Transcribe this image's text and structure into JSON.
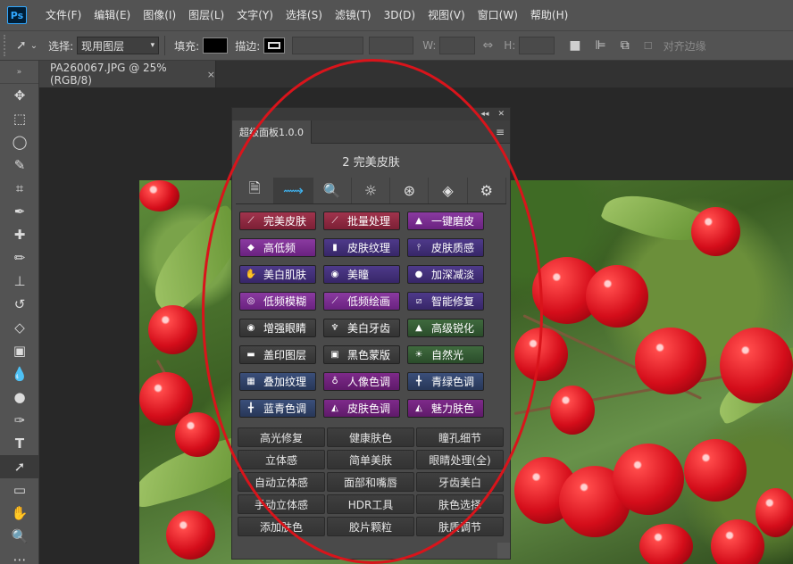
{
  "app": {
    "logo": "Ps"
  },
  "menu": [
    "文件(F)",
    "编辑(E)",
    "图像(I)",
    "图层(L)",
    "文字(Y)",
    "选择(S)",
    "滤镜(T)",
    "3D(D)",
    "视图(V)",
    "窗口(W)",
    "帮助(H)"
  ],
  "options": {
    "select_label": "选择:",
    "select_value": "现用图层",
    "fill_label": "填充:",
    "stroke_label": "描边:",
    "w_label": "W:",
    "h_label": "H:",
    "align_edges": "对齐边缘"
  },
  "document_tab": {
    "title": "PA260067.JPG @ 25%(RGB/8)",
    "close": "×"
  },
  "toolbar": {
    "icons": [
      "move-icon",
      "marquee-icon",
      "lasso-icon",
      "quick-select-icon",
      "crop-icon",
      "eyedropper-icon",
      "healing-brush-icon",
      "brush-icon",
      "clone-stamp-icon",
      "history-brush-icon",
      "eraser-icon",
      "gradient-icon",
      "blur-icon",
      "dodge-icon",
      "pen-icon",
      "type-icon",
      "path-select-icon",
      "rectangle-icon",
      "hand-icon",
      "zoom-icon",
      "more-icon"
    ]
  },
  "panel": {
    "tab_title": "超级面板1.0.0",
    "subtitle": "2 完美皮肤",
    "icon_tabs": [
      "document-icon",
      "pulse-icon",
      "search-icon",
      "light-icon",
      "circles-icon",
      "diamond-icon",
      "settings-icon"
    ],
    "buttons": [
      [
        {
          "label": "完美皮肤",
          "color": "red",
          "icon": "brush-icon"
        },
        {
          "label": "批量处理",
          "color": "red",
          "icon": "brush-icon"
        },
        {
          "label": "一键磨皮",
          "color": "purple",
          "icon": "bag-icon"
        }
      ],
      [
        {
          "label": "高低频",
          "color": "purple",
          "icon": "diamond-icon"
        },
        {
          "label": "皮肤纹理",
          "color": "indigo",
          "icon": "square-icon"
        },
        {
          "label": "皮肤质感",
          "color": "indigo",
          "icon": "pin-icon"
        }
      ],
      [
        {
          "label": "美白肌肤",
          "color": "indigo",
          "icon": "hand-icon"
        },
        {
          "label": "美瞳",
          "color": "indigo",
          "icon": "eye-dot-icon"
        },
        {
          "label": "加深减淡",
          "color": "indigo",
          "icon": "blob-icon"
        }
      ],
      [
        {
          "label": "低频模糊",
          "color": "purple",
          "icon": "blur-circle-icon"
        },
        {
          "label": "低频绘画",
          "color": "purple",
          "icon": "brush-icon"
        },
        {
          "label": "智能修复",
          "color": "indigo",
          "icon": "bandage-icon"
        }
      ],
      [
        {
          "label": "增强眼睛",
          "color": "dark",
          "icon": "eye-icon"
        },
        {
          "label": "美白牙齿",
          "color": "dark",
          "icon": "tooth-icon"
        },
        {
          "label": "高级锐化",
          "color": "green",
          "icon": "triangle-icon"
        }
      ],
      [
        {
          "label": "盖印图层",
          "color": "dark",
          "icon": "stamp-icon"
        },
        {
          "label": "黑色蒙版",
          "color": "dark",
          "icon": "mask-icon"
        },
        {
          "label": "自然光",
          "color": "green",
          "icon": "sun-icon"
        }
      ],
      [
        {
          "label": "叠加纹理",
          "color": "navy",
          "icon": "texture-icon"
        },
        {
          "label": "人像色调",
          "color": "magenta",
          "icon": "portrait-icon"
        },
        {
          "label": "青绿色调",
          "color": "navy",
          "icon": "cross-icon"
        }
      ],
      [
        {
          "label": "蓝青色调",
          "color": "navy",
          "icon": "cross-icon"
        },
        {
          "label": "皮肤色调",
          "color": "magenta",
          "icon": "skin-icon"
        },
        {
          "label": "魅力肤色",
          "color": "magenta",
          "icon": "skin-icon"
        }
      ]
    ],
    "text_buttons": [
      [
        "高光修复",
        "健康肤色",
        "瞳孔细节"
      ],
      [
        "立体感",
        "简单美肤",
        "眼睛处理(全)"
      ],
      [
        "自动立体感",
        "面部和嘴唇",
        "牙齿美白"
      ],
      [
        "手动立体感",
        "HDR工具",
        "肤色选择"
      ],
      [
        "添加肤色",
        "胶片颗粒",
        "肤质调节"
      ]
    ]
  },
  "colors": {
    "red": "#8e2a43",
    "purple": "#7a2e92",
    "indigo": "#433178",
    "dark": "#3c3c3c",
    "green": "#355b34",
    "navy": "#314368",
    "magenta": "#6e2379",
    "highlight": "#d9141b"
  }
}
